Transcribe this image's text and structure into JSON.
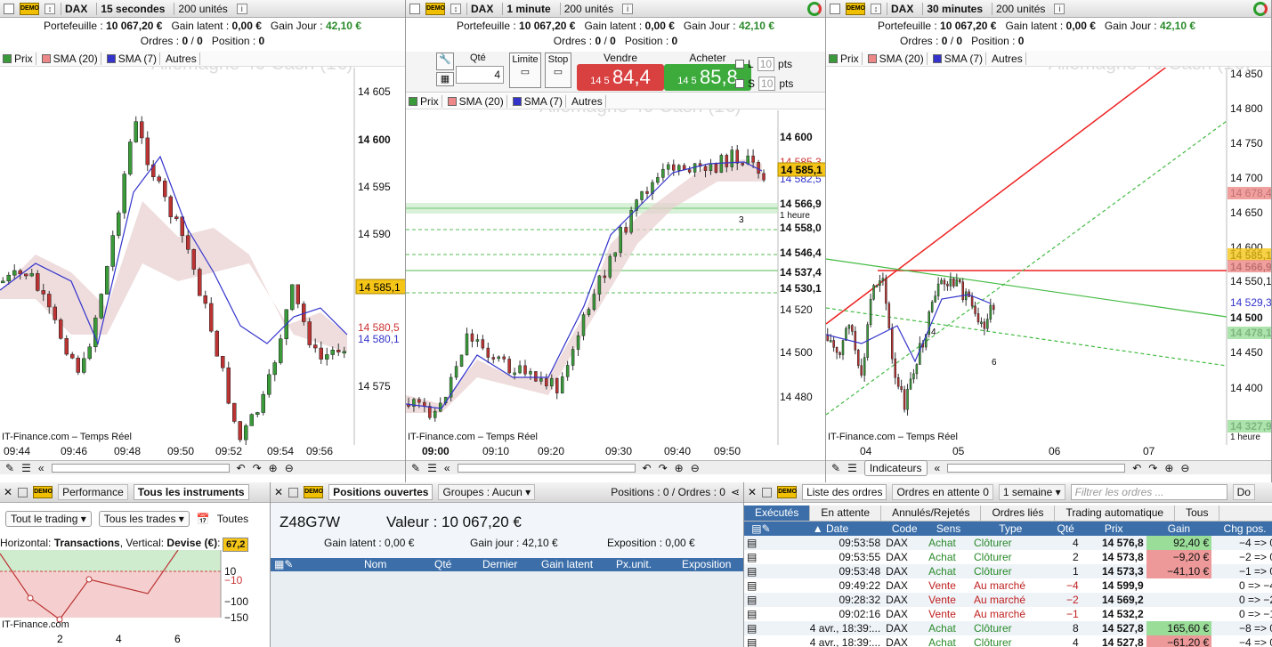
{
  "panes": [
    {
      "instrument": "DAX",
      "timeframe": "15 secondes",
      "units": "200 unités",
      "portfolio_label": "Portefeuille :",
      "portfolio": "10 067,20 €",
      "latent_label": "Gain latent :",
      "latent": "0,00 €",
      "day_label": "Gain Jour :",
      "day": "42,10 €",
      "orders_label": "Ordres :",
      "orders": "0",
      "orders2": "0",
      "position_label": "Position :",
      "position": "0",
      "legend": [
        "Prix",
        "SMA (20)",
        "SMA (7)",
        "Autres"
      ],
      "watermark": "Allemagne 40 Cash (1€)",
      "y_ticks": [
        "14 605",
        "14 600",
        "14 595",
        "14 590",
        "14 585,1",
        "14 580,5",
        "14 580,1",
        "14 575"
      ],
      "x_ticks": [
        "09:44",
        "09:46",
        "09:48",
        "09:50",
        "09:52",
        "09:54",
        "09:56"
      ],
      "source": "IT-Finance.com – Temps Réel"
    },
    {
      "instrument": "DAX",
      "timeframe": "1 minute",
      "units": "200 unités",
      "portfolio_label": "Portefeuille :",
      "portfolio": "10 067,20 €",
      "latent_label": "Gain latent :",
      "latent": "0,00 €",
      "day_label": "Gain Jour :",
      "day": "42,10 €",
      "orders_label": "Ordres :",
      "orders": "0",
      "orders2": "0",
      "position_label": "Position :",
      "position": "0",
      "qty_label": "Qté",
      "qty": "4",
      "limit": "Limite",
      "stop": "Stop",
      "sell_label": "Vendre",
      "sell_small": "14 5",
      "sell_big": "84,4",
      "buy_label": "Acheter",
      "buy_small": "14 5",
      "buy_big": "85,8",
      "l": "L",
      "s": "S",
      "pts_val": "10",
      "pts": "pts",
      "legend": [
        "Prix",
        "SMA (20)",
        "SMA (7)",
        "Autres"
      ],
      "watermark": "Allemagne 40 Cash (1€)",
      "y_ticks": [
        "14 600",
        "14 585,3",
        "14 585,1",
        "14 582,5",
        "14 566,9",
        "1 heure",
        "14 558,0",
        "14 546,4",
        "14 537,4",
        "14 530,1",
        "14 520",
        "14 500",
        "14 480"
      ],
      "x_ticks": [
        "09:00",
        "09:10",
        "09:20",
        "09:30",
        "09:40",
        "09:50"
      ],
      "marker": "3",
      "source": "IT-Finance.com – Temps Réel"
    },
    {
      "instrument": "DAX",
      "timeframe": "30 minutes",
      "units": "200 unités",
      "portfolio_label": "Portefeuille :",
      "portfolio": "10 067,20 €",
      "latent_label": "Gain latent :",
      "latent": "0,00 €",
      "day_label": "Gain Jour :",
      "day": "42,10 €",
      "orders_label": "Ordres :",
      "orders": "0",
      "orders2": "0",
      "position_label": "Position :",
      "position": "0",
      "legend": [
        "Prix",
        "SMA (20)",
        "SMA (7)",
        "Autres"
      ],
      "watermark": "Allemagne 40 Cash (1€)",
      "y_ticks": [
        "14 850",
        "14 800",
        "14 750",
        "14 700",
        "14 678,4",
        "14 650",
        "14 600",
        "14 585,1",
        "14 566,9",
        "14 550,1",
        "14 529,3",
        "14 500",
        "14 478,1",
        "14 450",
        "14 400",
        "14 327,9",
        "1 heure"
      ],
      "x_ticks": [
        "04",
        "05",
        "06",
        "07"
      ],
      "markers": [
        "4",
        "6"
      ],
      "source": "IT-Finance.com – Temps Réel",
      "indicators": "Indicateurs"
    }
  ],
  "perf": {
    "tab1": "Performance",
    "tab2": "Tous les instruments",
    "all_trading": "Tout le trading",
    "all_trades": "Tous les trades",
    "all": "Toutes",
    "axis_label": "Horizontal: ",
    "axis_h": "Transactions",
    "axis_sep": ", Vertical: ",
    "axis_v": "Devise (€)",
    "badge": "67,2",
    "y_ticks": [
      "10",
      "−10",
      "−100",
      "−150"
    ],
    "x_ticks": [
      "2",
      "4",
      "6"
    ],
    "source": "IT-Finance.com"
  },
  "positions": {
    "tab1": "Positions ouvertes",
    "tab2": "Groupes : Aucun",
    "summary": "Positions : 0 / Ordres : 0",
    "account": "Z48G7W",
    "value": "Valeur : 10 067,20 €",
    "latent": "Gain latent : 0,00 €",
    "day": "Gain jour : 42,10 €",
    "expo": "Exposition : 0,00 €",
    "cols": [
      "Nom",
      "Qté",
      "Dernier",
      "Gain latent",
      "Px.unit.",
      "Exposition"
    ]
  },
  "orders": {
    "tab1": "Liste des ordres",
    "tab2": "Ordres en attente",
    "tab2_count": "0",
    "period": "1 semaine",
    "filter": "Filtrer les ordres ...",
    "tab3": "Do",
    "subtabs": [
      "Exécutés",
      "En attente",
      "Annulés/Rejetés",
      "Ordres liés",
      "Trading automatique",
      "Tous"
    ],
    "cols": [
      "Date",
      "Code",
      "Sens",
      "Type",
      "Qté",
      "Prix",
      "Gain",
      "Chg pos."
    ],
    "rows": [
      [
        "09:53:58",
        "DAX",
        "Achat",
        "Clôturer",
        "4",
        "14 576,8",
        "92,40 €",
        "−4 => 0"
      ],
      [
        "09:53:55",
        "DAX",
        "Achat",
        "Clôturer",
        "2",
        "14 573,8",
        "−9,20 €",
        "−2 => 0"
      ],
      [
        "09:53:48",
        "DAX",
        "Achat",
        "Clôturer",
        "1",
        "14 573,3",
        "−41,10 €",
        "−1 => 0"
      ],
      [
        "09:49:22",
        "DAX",
        "Vente",
        "Au marché",
        "−4",
        "14 599,9",
        "",
        "0 => −4"
      ],
      [
        "09:28:32",
        "DAX",
        "Vente",
        "Au marché",
        "−2",
        "14 569,2",
        "",
        "0 => −2"
      ],
      [
        "09:02:16",
        "DAX",
        "Vente",
        "Au marché",
        "−1",
        "14 532,2",
        "",
        "0 => −1"
      ],
      [
        "4 avr., 18:39:...",
        "DAX",
        "Achat",
        "Clôturer",
        "8",
        "14 527,8",
        "165,60 €",
        "−8 => 0"
      ],
      [
        "4 avr., 18:39:...",
        "DAX",
        "Achat",
        "Clôturer",
        "4",
        "14 527,8",
        "−61,20 €",
        "−4 => 0"
      ]
    ]
  }
}
